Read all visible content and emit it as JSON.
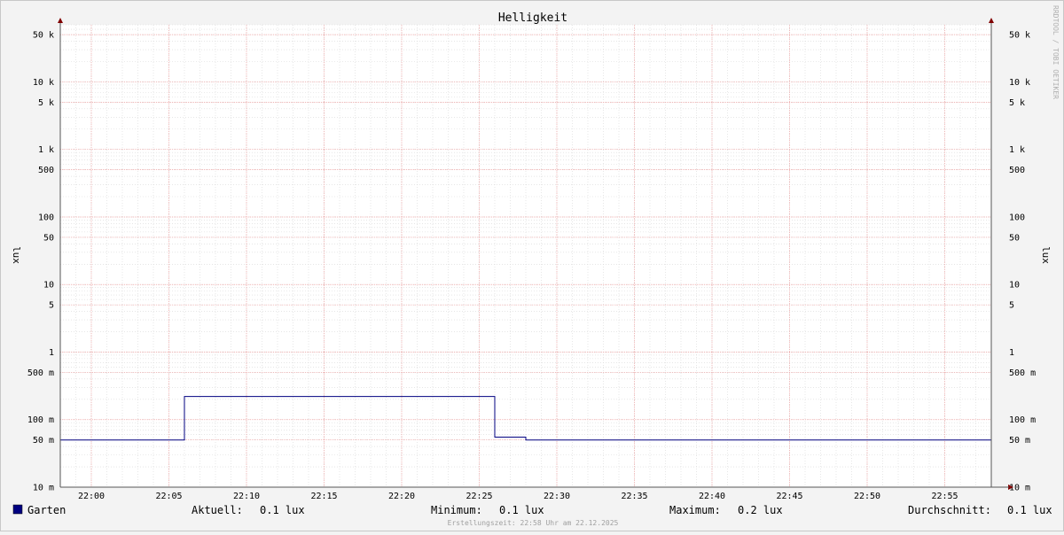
{
  "chart_data": {
    "type": "line",
    "title": "Helligkeit",
    "ylabel": "lux",
    "ylabel_right": "lux",
    "yscale": "log",
    "ylim": [
      0.01,
      70000
    ],
    "xlim": [
      "21:58",
      "22:58"
    ],
    "x_ticks": [
      "22:00",
      "22:05",
      "22:10",
      "22:15",
      "22:20",
      "22:25",
      "22:30",
      "22:35",
      "22:40",
      "22:45",
      "22:50",
      "22:55"
    ],
    "y_ticks": [
      {
        "value": 50000,
        "label": "50 k"
      },
      {
        "value": 10000,
        "label": "10 k"
      },
      {
        "value": 5000,
        "label": "5 k"
      },
      {
        "value": 1000,
        "label": "1 k"
      },
      {
        "value": 500,
        "label": "500"
      },
      {
        "value": 100,
        "label": "100"
      },
      {
        "value": 50,
        "label": "50"
      },
      {
        "value": 10,
        "label": "10"
      },
      {
        "value": 5,
        "label": "5"
      },
      {
        "value": 1,
        "label": "1"
      },
      {
        "value": 0.5,
        "label": "500 m"
      },
      {
        "value": 0.1,
        "label": "100 m"
      },
      {
        "value": 0.05,
        "label": "50 m"
      },
      {
        "value": 0.01,
        "label": "10 m"
      }
    ],
    "grid": true,
    "series": [
      {
        "name": "Garten",
        "color": "#000080",
        "points": [
          {
            "x": "21:58",
            "y": 0.05
          },
          {
            "x": "22:06",
            "y": 0.05
          },
          {
            "x": "22:06",
            "y": 0.22
          },
          {
            "x": "22:26",
            "y": 0.22
          },
          {
            "x": "22:26",
            "y": 0.055
          },
          {
            "x": "22:28",
            "y": 0.055
          },
          {
            "x": "22:28",
            "y": 0.05
          },
          {
            "x": "22:58",
            "y": 0.05
          }
        ]
      }
    ]
  },
  "legend": {
    "series_name": "Garten",
    "swatch_color": "#000080",
    "stats": [
      {
        "label": "Aktuell:",
        "value": "0.1 lux"
      },
      {
        "label": "Minimum:",
        "value": "0.1 lux"
      },
      {
        "label": "Maximum:",
        "value": "0.2 lux"
      },
      {
        "label": "Durchschnitt:",
        "value": "0.1 lux"
      }
    ]
  },
  "footer": "Erstellungszeit: 22:58 Uhr am 22.12.2025",
  "watermark": "RRDTOOL / TOBI OETIKER",
  "colors": {
    "background": "#f3f3f3",
    "canvas": "#ffffff",
    "major_grid": "#f0a0a0",
    "minor_grid": "#d8d8d8",
    "axis": "#555555",
    "arrow": "#800000"
  }
}
